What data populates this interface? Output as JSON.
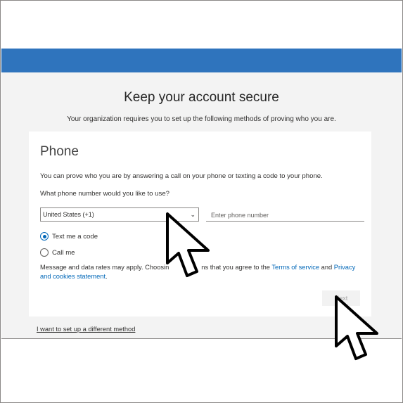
{
  "page": {
    "title": "Keep your account secure",
    "subtitle": "Your organization requires you to set up the following methods of proving who you are."
  },
  "card": {
    "title": "Phone",
    "description": "You can prove who you are by answering a call on your phone or texting a code to your phone.",
    "question": "What phone number would you like to use?",
    "country_value": "United States (+1)",
    "phone_placeholder": "Enter phone number",
    "options": [
      {
        "label": "Text me a code",
        "selected": true
      },
      {
        "label": "Call me",
        "selected": false
      }
    ],
    "disclaimer_prefix": "Message and data rates may apply. Choosin",
    "disclaimer_middle": "ns that you agree to the ",
    "terms_link": "Terms of service",
    "and_text": " and ",
    "privacy_link": "Privacy and cookies statement",
    "period": ".",
    "next_label": "Next"
  },
  "footer": {
    "alt_method": "I want to set up a different method"
  },
  "colors": {
    "header_bar": "#2f74bd",
    "link": "#0067b8",
    "radio_selected": "#0067b8"
  },
  "icons": [
    "chevron-down-icon",
    "mouse-pointer-icon"
  ]
}
